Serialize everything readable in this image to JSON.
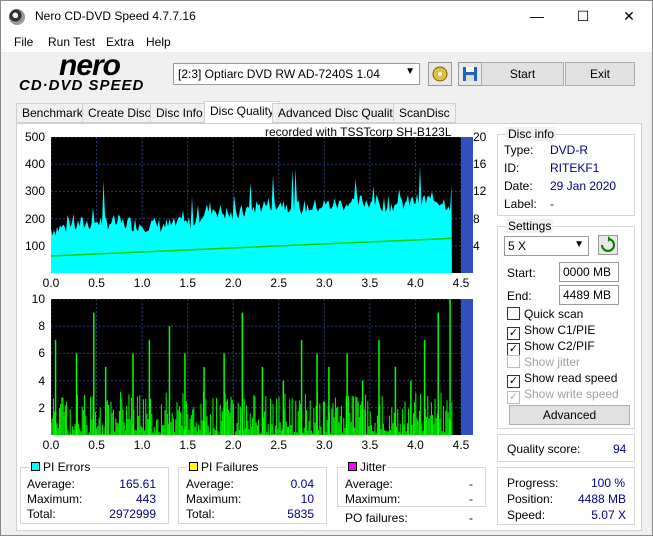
{
  "window": {
    "title": "Nero CD-DVD Speed 4.7.7.16",
    "min": "—",
    "max": "☐",
    "close": "✕"
  },
  "menu": [
    "File",
    "Run Test",
    "Extra",
    "Help"
  ],
  "logo": {
    "top": "nero",
    "bottom": "CD·DVD SPEED"
  },
  "toolbar": {
    "drive": "[2:3]   Optiarc DVD RW AD-7240S 1.04",
    "start": "Start",
    "exit": "Exit"
  },
  "tabs": [
    "Benchmark",
    "Create Disc",
    "Disc Info",
    "Disc Quality",
    "Advanced Disc Quality",
    "ScanDisc"
  ],
  "active_tab": "Disc Quality",
  "chart_title": "recorded with TSSTcorp SH-B123L",
  "disc_info": {
    "title": "Disc info",
    "rows": [
      {
        "label": "Type:",
        "value": "DVD-R"
      },
      {
        "label": "ID:",
        "value": "RITEKF1"
      },
      {
        "label": "Date:",
        "value": "29 Jan 2020"
      },
      {
        "label": "Label:",
        "value": "-"
      }
    ]
  },
  "settings": {
    "title": "Settings",
    "speed": "5 X",
    "start_label": "Start:",
    "start_value": "0000 MB",
    "end_label": "End:",
    "end_value": "4489 MB",
    "checks": [
      {
        "label": "Quick scan",
        "checked": false,
        "disabled": false
      },
      {
        "label": "Show C1/PIE",
        "checked": true,
        "disabled": false
      },
      {
        "label": "Show C2/PIF",
        "checked": true,
        "disabled": false
      },
      {
        "label": "Show jitter",
        "checked": false,
        "disabled": true
      },
      {
        "label": "Show read speed",
        "checked": true,
        "disabled": false
      },
      {
        "label": "Show write speed",
        "checked": true,
        "disabled": true
      }
    ],
    "advanced": "Advanced"
  },
  "quality": {
    "label": "Quality score:",
    "value": "94"
  },
  "progress": [
    {
      "label": "Progress:",
      "value": "100 %"
    },
    {
      "label": "Position:",
      "value": "4488 MB"
    },
    {
      "label": "Speed:",
      "value": "5.07 X"
    }
  ],
  "pi_errors": {
    "title": "PI Errors",
    "color": "#00ffff",
    "rows": [
      {
        "label": "Average:",
        "value": "165.61"
      },
      {
        "label": "Maximum:",
        "value": "443"
      },
      {
        "label": "Total:",
        "value": "2972999"
      }
    ]
  },
  "pi_failures": {
    "title": "PI Failures",
    "color": "#ffff00",
    "rows": [
      {
        "label": "Average:",
        "value": "0.04"
      },
      {
        "label": "Maximum:",
        "value": "10"
      },
      {
        "label": "Total:",
        "value": "5835"
      }
    ]
  },
  "jitter": {
    "title": "Jitter",
    "color": "#ff00ff",
    "rows": [
      {
        "label": "Average:",
        "value": "-"
      },
      {
        "label": "Maximum:",
        "value": "-"
      }
    ]
  },
  "po_failures": {
    "label": "PO failures:",
    "value": "-"
  },
  "chart_data": [
    {
      "type": "area",
      "title": "recorded with TSSTcorp SH-B123L",
      "xlim": [
        0,
        4.5
      ],
      "ylim": [
        0,
        500
      ],
      "y2lim": [
        0,
        20
      ],
      "x_ticks": [
        "0.0",
        "0.5",
        "1.0",
        "1.5",
        "2.0",
        "2.5",
        "3.0",
        "3.5",
        "4.0",
        "4.5"
      ],
      "y_ticks": [
        "500",
        "400",
        "300",
        "200",
        "100"
      ],
      "y2_ticks": [
        "20",
        "16",
        "12",
        "8",
        "4"
      ],
      "series": [
        {
          "color": "#00ffff",
          "x": [
            0,
            0.25,
            0.5,
            0.75,
            1.0,
            1.25,
            1.5,
            1.75,
            2.0,
            2.25,
            2.5,
            2.75,
            3.0,
            3.25,
            3.5,
            3.75,
            4.0,
            4.25,
            4.4
          ],
          "values": [
            160,
            175,
            190,
            185,
            180,
            175,
            180,
            240,
            210,
            245,
            260,
            240,
            250,
            255,
            265,
            250,
            265,
            270,
            250
          ]
        },
        {
          "color": "#00cc00",
          "x": [
            0,
            4.4
          ],
          "values": [
            2.5,
            5.1
          ]
        }
      ]
    },
    {
      "type": "bar",
      "xlim": [
        0,
        4.5
      ],
      "ylim": [
        0,
        10
      ],
      "x_ticks": [
        "0.0",
        "0.5",
        "1.0",
        "1.5",
        "2.0",
        "2.5",
        "3.0",
        "3.5",
        "4.0",
        "4.5"
      ],
      "y_ticks": [
        "10",
        "8",
        "6",
        "4",
        "2"
      ],
      "series": [
        {
          "color": "#00ff00",
          "x": [
            0.05,
            0.28,
            0.47,
            0.6,
            0.9,
            1.08,
            1.3,
            1.47,
            1.68,
            1.9,
            2.1,
            2.32,
            2.55,
            2.75,
            2.92,
            3.05,
            3.25,
            3.42,
            3.6,
            3.78,
            3.95,
            4.1,
            4.25,
            4.38
          ],
          "values": [
            7,
            6,
            9,
            5,
            6,
            7,
            8,
            6,
            5,
            6,
            9,
            5,
            4,
            7,
            6,
            5,
            6,
            4,
            7,
            5,
            4,
            7,
            9,
            10
          ]
        }
      ]
    }
  ]
}
